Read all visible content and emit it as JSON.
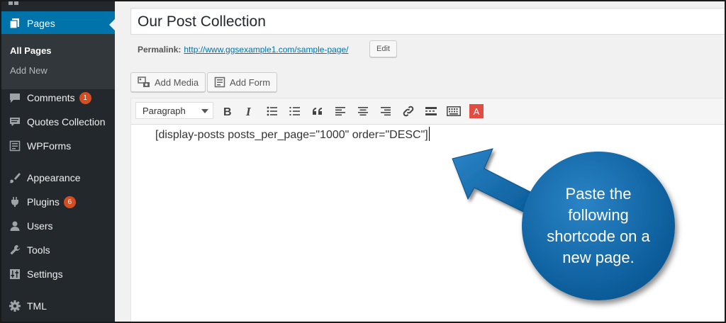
{
  "sidebar": {
    "active_item": "Pages",
    "submenu": [
      "All Pages",
      "Add New"
    ],
    "items": [
      {
        "label": "Comments",
        "badge": "1"
      },
      {
        "label": "Quotes Collection"
      },
      {
        "label": "WPForms"
      },
      {
        "label": "Appearance"
      },
      {
        "label": "Plugins",
        "badge": "6"
      },
      {
        "label": "Users"
      },
      {
        "label": "Tools"
      },
      {
        "label": "Settings"
      },
      {
        "label": "TML"
      }
    ],
    "colors": {
      "bg": "#23282d",
      "active": "#0073aa",
      "badge": "#d54e21"
    }
  },
  "editor": {
    "title": "Our Post Collection",
    "permalink_label": "Permalink:",
    "permalink_url": "http://www.ggsexample1.com/sample-page/",
    "edit_label": "Edit",
    "add_media_label": "Add Media",
    "add_form_label": "Add Form",
    "format_select_value": "Paragraph",
    "toolbar_icons": [
      "bold-icon",
      "italic-icon",
      "bulleted-list-icon",
      "numbered-list-icon",
      "blockquote-icon",
      "align-left-icon",
      "align-center-icon",
      "align-right-icon",
      "link-icon",
      "read-more-icon",
      "toolbar-toggle-icon",
      "text-color-icon"
    ],
    "text_color_label": "A",
    "content": "[display-posts posts_per_page=\"1000\" order=\"DESC\"]"
  },
  "callout": {
    "text": "Paste the following shortcode on a new page.",
    "color": "#0b5c99"
  }
}
